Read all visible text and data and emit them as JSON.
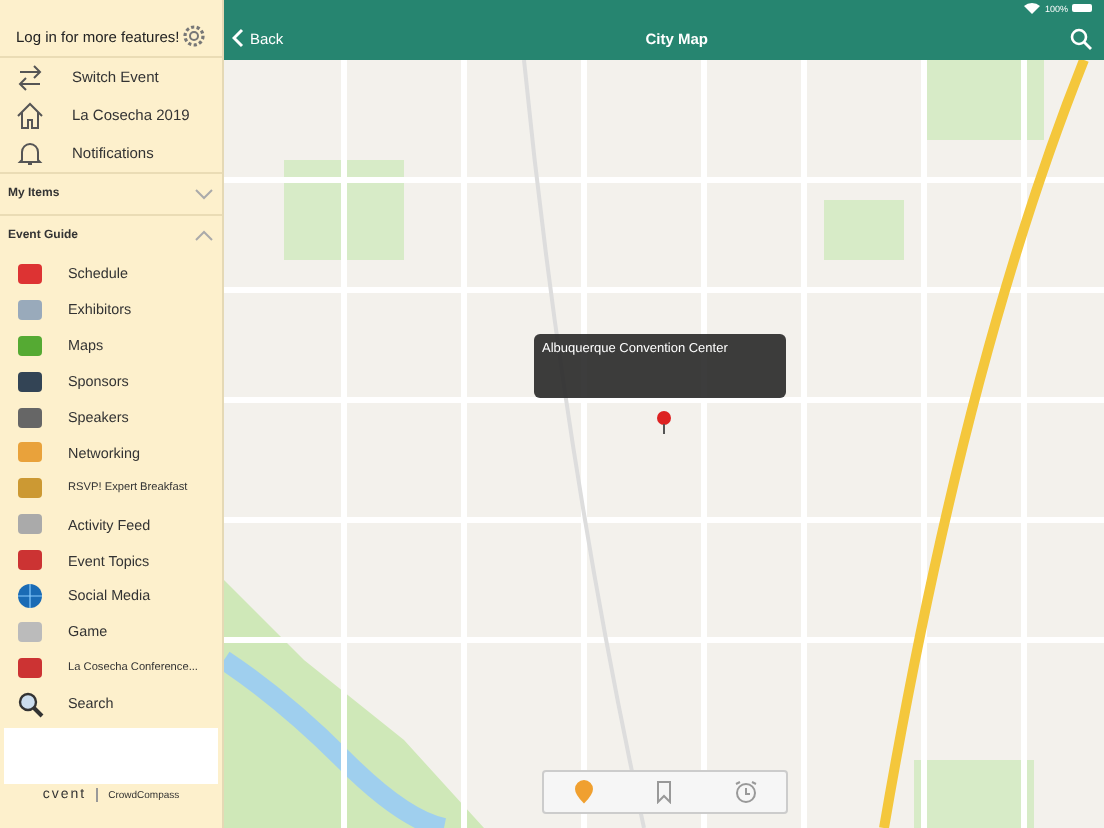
{
  "sidebar": {
    "login_text": "Log in for more features!",
    "top_items": [
      {
        "label": "Switch Event"
      },
      {
        "label": "La Cosecha 2019"
      },
      {
        "label": "Notifications"
      }
    ],
    "sections": [
      {
        "title": "My Items",
        "expanded": false
      },
      {
        "title": "Event Guide",
        "expanded": true,
        "items": [
          {
            "label": "Schedule"
          },
          {
            "label": "Exhibitors"
          },
          {
            "label": "Maps"
          },
          {
            "label": "Sponsors"
          },
          {
            "label": "Speakers"
          },
          {
            "label": "Networking"
          },
          {
            "label": "RSVP! Expert Breakfast"
          },
          {
            "label": "Activity Feed"
          },
          {
            "label": "Event Topics"
          },
          {
            "label": "Social Media"
          },
          {
            "label": "Game"
          },
          {
            "label": "La Cosecha Conference..."
          },
          {
            "label": "Search"
          }
        ]
      }
    ],
    "footer": {
      "brand": "cvent",
      "partner": "CrowdCompass"
    }
  },
  "status_bar": {
    "battery": "100%"
  },
  "nav": {
    "back": "Back",
    "title": "City Map"
  },
  "map": {
    "callout": "Albuquerque Convention Center"
  },
  "toolbar": [
    {
      "selected": true
    },
    {
      "selected": false
    },
    {
      "selected": false
    }
  ]
}
